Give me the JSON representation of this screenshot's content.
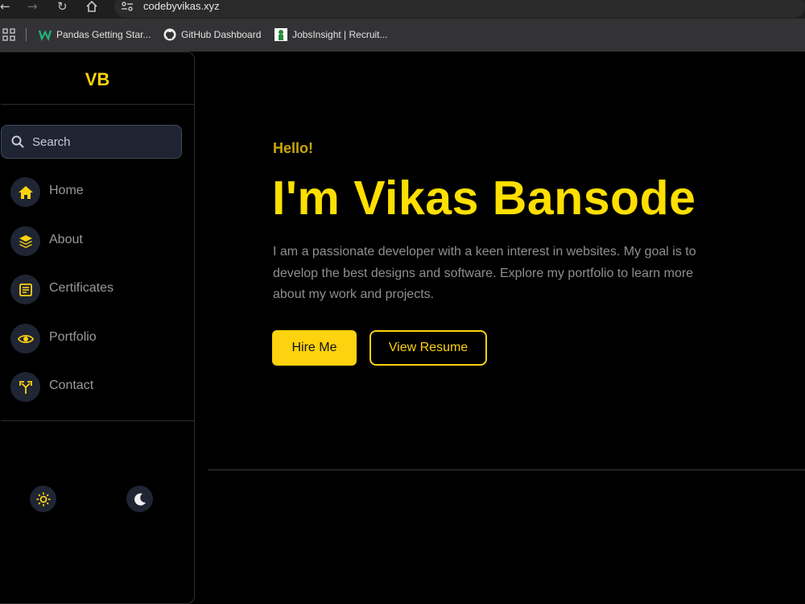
{
  "browser": {
    "url": "codebyvikas.xyz",
    "bookmarks": [
      {
        "label": "Pandas Getting Star...",
        "icon": "pandas-w-icon"
      },
      {
        "label": "GitHub Dashboard",
        "icon": "github-icon"
      },
      {
        "label": "JobsInsight | Recruit...",
        "icon": "jobsinsight-icon"
      }
    ]
  },
  "sidebar": {
    "logo": "VB",
    "search_placeholder": "Search",
    "items": [
      {
        "label": "Home",
        "icon": "home-icon"
      },
      {
        "label": "About",
        "icon": "layers-icon"
      },
      {
        "label": "Certificates",
        "icon": "certificate-icon"
      },
      {
        "label": "Portfolio",
        "icon": "eye-icon"
      },
      {
        "label": "Contact",
        "icon": "split-arrows-icon"
      }
    ],
    "theme": {
      "light": "sun-icon",
      "dark": "moon-icon"
    }
  },
  "hero": {
    "greeting": "Hello!",
    "title": "I'm Vikas Bansode",
    "description": "I am a passionate developer with a keen interest in websites. My goal is to develop the best designs and software. Explore my portfolio to learn more about my work and projects.",
    "primary_button": "Hire Me",
    "secondary_button": "View Resume"
  },
  "colors": {
    "accent": "#fdd20e",
    "background": "#000000",
    "nav_circle": "#1f2533",
    "muted_text": "#8f8f8f"
  }
}
